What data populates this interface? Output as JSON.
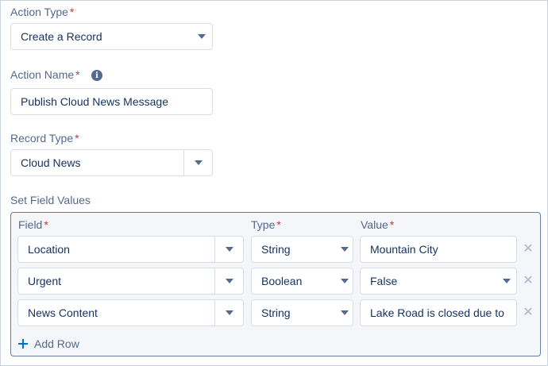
{
  "action_type": {
    "label": "Action Type",
    "required_mark": "*",
    "value": "Create a Record"
  },
  "action_name": {
    "label": "Action Name",
    "required_mark": "*",
    "info_glyph": "i",
    "value": "Publish Cloud News Message"
  },
  "record_type": {
    "label": "Record Type",
    "required_mark": "*",
    "value": "Cloud News"
  },
  "set_field_values": {
    "label": "Set Field Values",
    "headers": {
      "field": "Field",
      "type": "Type",
      "value": "Value",
      "required_mark": "*"
    },
    "rows": [
      {
        "field": "Location",
        "type": "String",
        "value": "Mountain City",
        "value_is_picklist": false
      },
      {
        "field": "Urgent",
        "type": "Boolean",
        "value": "False",
        "value_is_picklist": true
      },
      {
        "field": "News Content",
        "type": "String",
        "value": "Lake Road is closed due to",
        "value_is_picklist": false
      }
    ],
    "remove_glyph": "✕",
    "add_row_label": "Add Row"
  },
  "icons": {
    "info": "info-icon",
    "dropdown": "chevron-down-icon",
    "remove": "close-icon",
    "add": "plus-icon"
  },
  "colors": {
    "text": "#16325c",
    "label": "#54698d",
    "required": "#c23934",
    "border": "#d8dde6",
    "panel_bg": "#f4f6f9",
    "panel_border": "#5f7fa8",
    "brand": "#0070d2"
  }
}
